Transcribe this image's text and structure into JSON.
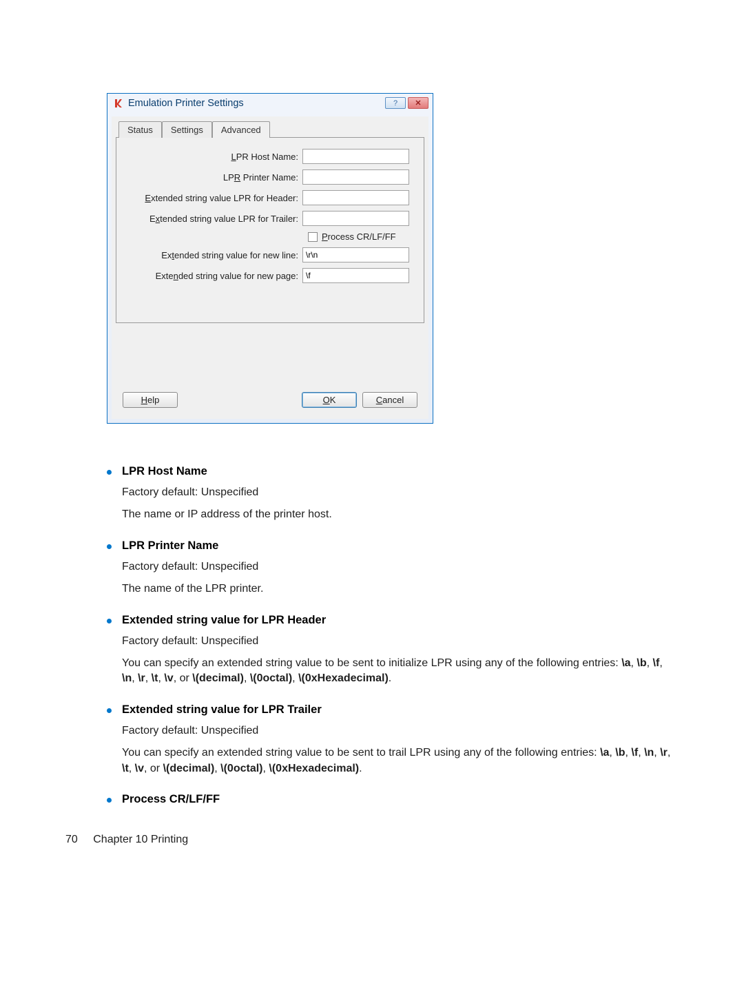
{
  "dialog": {
    "title": "Emulation Printer Settings",
    "tabs": {
      "status": "Status",
      "settings": "Settings",
      "advanced": "Advanced"
    },
    "fields": {
      "host_name_label": "LPR Host Name:",
      "host_name_value": "",
      "printer_name_label": "LPR Printer Name:",
      "printer_name_value": "",
      "header_label": "Extended string value LPR for Header:",
      "header_value": "",
      "trailer_label": "Extended string value LPR for Trailer:",
      "trailer_value": "",
      "process_crlfff_label": "Process CR/LF/FF",
      "new_line_label": "Extended string value for new line:",
      "new_line_value": "\\r\\n",
      "new_page_label": "Extended string value for new page:",
      "new_page_value": "\\f"
    },
    "buttons": {
      "help": "Help",
      "ok": "OK",
      "cancel": "Cancel"
    }
  },
  "items": [
    {
      "title": "LPR Host Name",
      "paragraphs": [
        "Factory default: Unspecified",
        "The name or IP address of the printer host."
      ]
    },
    {
      "title": "LPR Printer Name",
      "paragraphs": [
        "Factory default: Unspecified",
        "The name of the LPR printer."
      ]
    },
    {
      "title": "Extended string value for LPR Header",
      "paragraphs": [
        "Factory default: Unspecified"
      ],
      "rich": "You can specify an extended string value to be sent to initialize LPR using any of the following entries: <b>\\a</b>, <b>\\b</b>, <b>\\f</b>, <b>\\n</b>, <b>\\r</b>, <b>\\t</b>, <b>\\v</b>, or <b>\\(decimal)</b>, <b>\\(0octal)</b>, <b>\\(0xHexadecimal)</b>."
    },
    {
      "title": "Extended string value for LPR Trailer",
      "paragraphs": [
        "Factory default: Unspecified"
      ],
      "rich": "You can specify an extended string value to be sent to trail LPR using any of the following entries: <b>\\a</b>, <b>\\b</b>, <b>\\f</b>, <b>\\n</b>, <b>\\r</b>, <b>\\t</b>, <b>\\v</b>, or <b>\\(decimal)</b>, <b>\\(0octal)</b>, <b>\\(0xHexadecimal)</b>."
    },
    {
      "title": "Process CR/LF/FF",
      "paragraphs": []
    }
  ],
  "footer": {
    "page_number": "70",
    "chapter": "Chapter 10   Printing"
  }
}
